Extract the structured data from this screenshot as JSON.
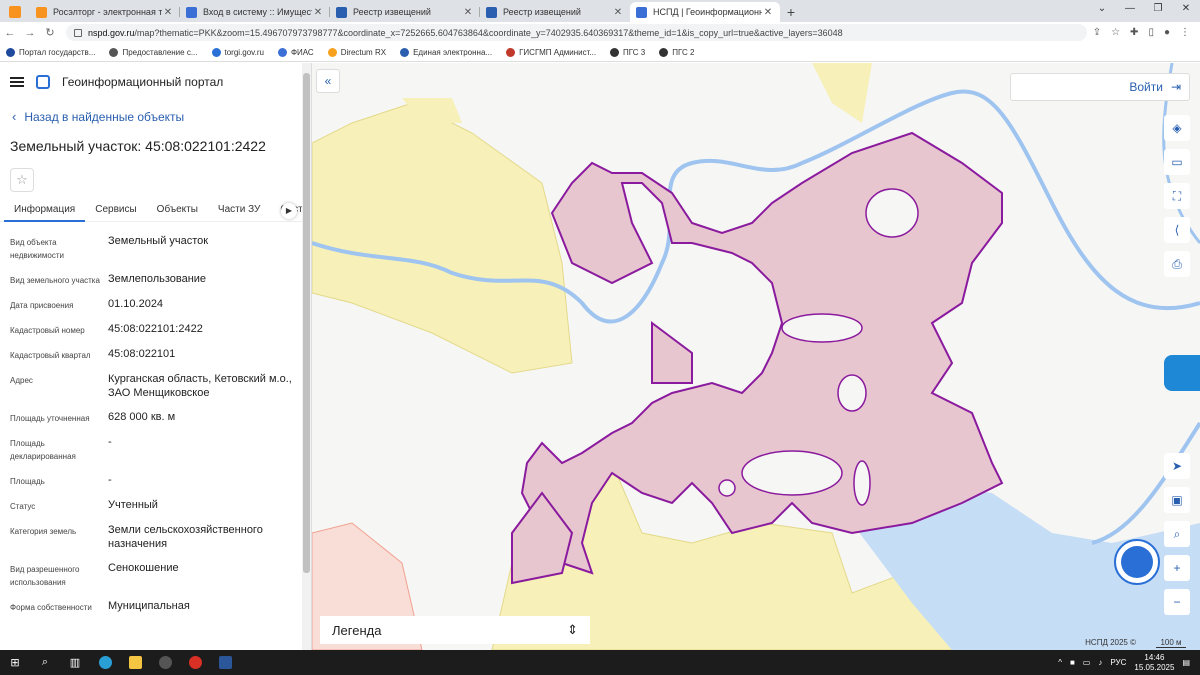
{
  "browser": {
    "tabs": [
      {
        "title": "Росэлторг - электронная торговая",
        "fav": "#f7931e"
      },
      {
        "title": "Вход в систему :: Имущественные",
        "fav": "#3b6fd6"
      },
      {
        "title": "Реестр извещений",
        "fav": "#2a5fb0"
      },
      {
        "title": "Реестр извещений",
        "fav": "#2a5fb0"
      },
      {
        "title": "НСПД | Геоинформационный п",
        "fav": "#3b6fd6"
      }
    ],
    "url_host": "nspd.gov.ru",
    "url_path": "/map?thematic=PKK&zoom=15.496707973798777&coordinate_x=7252665.604763864&coordinate_y=7402935.640369317&theme_id=1&is_copy_url=true&active_layers=36048",
    "bookmarks": [
      {
        "label": "Портал государств...",
        "color": "#1f4a9e"
      },
      {
        "label": "Предоставление с...",
        "color": "#555"
      },
      {
        "label": "torgi.gov.ru",
        "color": "#2a6fd6"
      },
      {
        "label": "ФИАС",
        "color": "#3b6fd6"
      },
      {
        "label": "Directum RX",
        "color": "#f7a21e"
      },
      {
        "label": "Единая электронна...",
        "color": "#2a5fb0"
      },
      {
        "label": "ГИСГМП Админист...",
        "color": "#c0392b"
      },
      {
        "label": "ПГС 3",
        "color": "#333"
      },
      {
        "label": "ПГС 2",
        "color": "#333"
      }
    ]
  },
  "panel": {
    "app_title": "Геоинформационный портал",
    "back_label": "Назад в найденные объекты",
    "object_title": "Земельный участок: 45:08:022101:2422",
    "tabs": [
      "Информация",
      "Сервисы",
      "Объекты",
      "Части ЗУ",
      "Соста"
    ],
    "rows": [
      {
        "k": "Вид объекта недвижимости",
        "v": "Земельный участок"
      },
      {
        "k": "Вид земельного участка",
        "v": "Землепользование"
      },
      {
        "k": "Дата присвоения",
        "v": "01.10.2024"
      },
      {
        "k": "Кадастровый номер",
        "v": "45:08:022101:2422"
      },
      {
        "k": "Кадастровый квартал",
        "v": "45:08:022101"
      },
      {
        "k": "Адрес",
        "v": "Курганская область, Кетовский м.о., ЗАО Менщиковское"
      },
      {
        "k": "Площадь уточненная",
        "v": "628 000 кв. м"
      },
      {
        "k": "Площадь декларированная",
        "v": "-"
      },
      {
        "k": "Площадь",
        "v": "-"
      },
      {
        "k": "Статус",
        "v": "Учтенный"
      },
      {
        "k": "Категория земель",
        "v": "Земли сельскохозяйственного назначения"
      },
      {
        "k": "Вид разрешенного использования",
        "v": "Сенокошение"
      },
      {
        "k": "Форма собственности",
        "v": "Муниципальная"
      }
    ]
  },
  "map": {
    "login_label": "Войти",
    "legend_label": "Легенда",
    "attribution": "НСПД 2025 ©",
    "scale_label": "100 м",
    "colors": {
      "parcel_fill": "#e8c6cf",
      "parcel_stroke": "#8a1a9e",
      "field": "#f7f0b8",
      "water": "#c6ddf6",
      "river": "#9ec4ef",
      "accent": "#2a5fb0"
    }
  },
  "taskbar": {
    "lang": "РУС",
    "time": "14:46",
    "date": "15.05.2025"
  }
}
